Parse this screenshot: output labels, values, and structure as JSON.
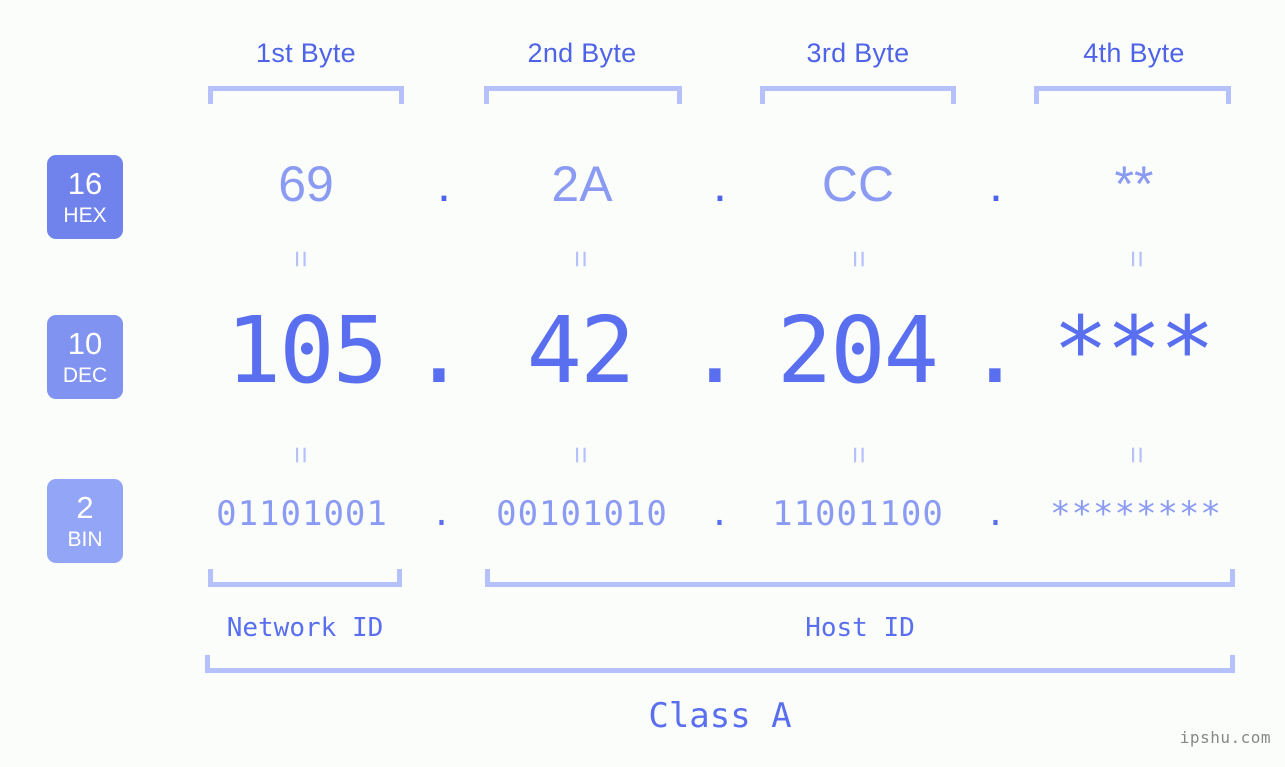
{
  "page": {
    "background_color": "#fbfdfa",
    "accent_color": "#5a6ff0",
    "light_accent_color": "#8b9bf3",
    "bracket_color": "#b6c0fb",
    "watermark": "ipshu.com"
  },
  "byte_headers": [
    {
      "label": "1st Byte"
    },
    {
      "label": "2nd Byte"
    },
    {
      "label": "3rd Byte"
    },
    {
      "label": "4th Byte"
    }
  ],
  "bases": [
    {
      "number": "16",
      "abbr": "HEX",
      "color": "#7083ec"
    },
    {
      "number": "10",
      "abbr": "DEC",
      "color": "#8093f0"
    },
    {
      "number": "2",
      "abbr": "BIN",
      "color": "#93a5f6"
    }
  ],
  "rows": {
    "hex": {
      "base_number": "16",
      "base_abbr": "HEX",
      "values": [
        "69",
        "2A",
        "CC",
        "**"
      ],
      "separator": "."
    },
    "dec": {
      "base_number": "10",
      "base_abbr": "DEC",
      "values": [
        "105",
        "42",
        "204",
        "***"
      ],
      "separator": "."
    },
    "bin": {
      "base_number": "2",
      "base_abbr": "BIN",
      "values": [
        "01101001",
        "00101010",
        "11001100",
        "********"
      ],
      "separator": "."
    }
  },
  "connectors": {
    "symbol": "=",
    "count_per_row": 4
  },
  "segments": {
    "network_id": "Network ID",
    "host_id": "Host ID",
    "class": "Class A"
  }
}
